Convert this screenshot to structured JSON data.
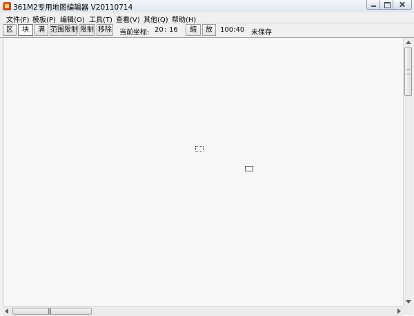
{
  "window": {
    "title": "361M2专用地图编辑器 V20110714"
  },
  "menu": [
    {
      "label": "文件(F)"
    },
    {
      "label": "模板(P)"
    },
    {
      "label": "编辑(O)"
    },
    {
      "label": "工具(T)"
    },
    {
      "label": "查看(V)"
    },
    {
      "label": "其他(Q)"
    },
    {
      "label": "帮助(H)"
    }
  ],
  "toolbar": {
    "zone_label": "区",
    "block_label": "块",
    "full_label": "满",
    "range_limit_label": "范围限制",
    "limit_label": "限制",
    "remove_label": "移除",
    "coord_label": "当前坐标:",
    "coord_x": "20",
    "coord_sep": ":",
    "coord_y": "16",
    "shrink_label": "缩",
    "zoom_label": "放",
    "scale_value": "100:40",
    "save_status": "未保存"
  },
  "scrollbar": {
    "h_grip": "|||"
  },
  "icons": {
    "app": "map-editor-icon",
    "minimize": "minimize-icon",
    "maximize": "maximize-icon",
    "close": "close-icon"
  }
}
